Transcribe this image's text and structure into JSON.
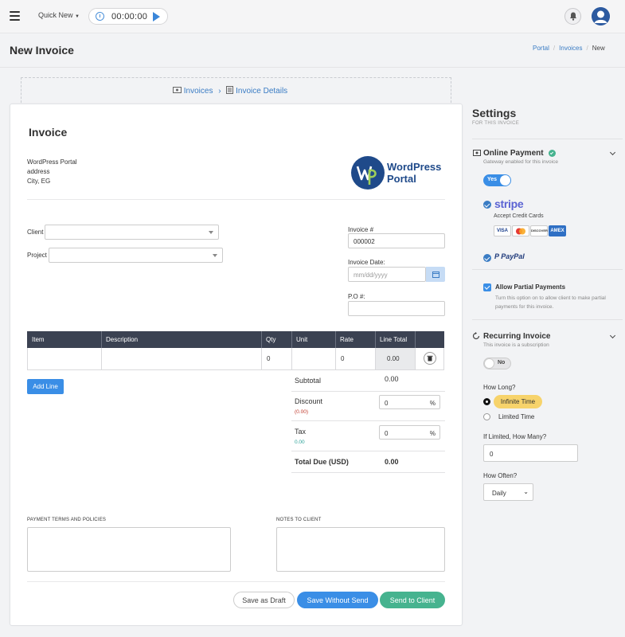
{
  "topbar": {
    "quick_new": "Quick New",
    "timer": "00:00:00"
  },
  "header": {
    "title": "New Invoice",
    "breadcrumb": [
      "Portal",
      "Invoices",
      "New"
    ]
  },
  "steps": {
    "step1": "Invoices",
    "step2": "Invoice Details"
  },
  "invoice": {
    "title": "Invoice",
    "company_lines": [
      "WordPress Portal",
      "address",
      "City, EG"
    ],
    "logo_text_line1": "WordPress",
    "logo_text_line2": "Portal",
    "client_label": "Client",
    "project_label": "Project",
    "invoice_no_label": "Invoice #",
    "invoice_no": "000002",
    "date_label": "Invoice Date:",
    "date_placeholder": "mm/dd/yyyy",
    "po_label": "P.O #:"
  },
  "table": {
    "headers": [
      "Item",
      "Description",
      "Qty",
      "Unit",
      "Rate",
      "Line Total"
    ],
    "row": {
      "qty": "0",
      "rate": "0",
      "total": "0.00"
    },
    "add_line": "Add Line"
  },
  "totals": {
    "subtotal_label": "Subtotal",
    "subtotal": "0.00",
    "discount_label": "Discount",
    "discount_value": "(0.00)",
    "discount_input": "0",
    "tax_label": "Tax",
    "tax_value": "0.00",
    "tax_input": "0",
    "percent": "%",
    "total_label": "Total Due (USD)",
    "total": "0.00"
  },
  "notes": {
    "terms_label": "PAYMENT TERMS AND POLICIES",
    "notes_label": "NOTES TO CLIENT"
  },
  "actions": {
    "draft": "Save as Draft",
    "save": "Save Without Send",
    "send": "Send to Client"
  },
  "settings": {
    "title": "Settings",
    "subtitle": "FOR THIS INVOICE",
    "online_payment": "Online Payment",
    "online_payment_sub": "Gateway enabled for this invoice",
    "toggle_yes": "Yes",
    "stripe": "stripe",
    "accept_cards": "Accept Credit Cards",
    "cards": [
      "VISA",
      "",
      "DISCOVER",
      "AMEX"
    ],
    "paypal": "PayPal",
    "partial_title": "Allow Partial Payments",
    "partial_sub": "Turn this option on to allow client to make partial payments for this invoice.",
    "recurring": "Recurring Invoice",
    "recurring_sub": "This invoice is a subscription",
    "toggle_no": "No",
    "how_long": "How Long?",
    "infinite": "Infinite Time",
    "limited": "Limited Time",
    "if_limited": "If Limited, How Many?",
    "how_many_value": "0",
    "how_often": "How Often?",
    "frequency": "Daily"
  },
  "colors": {
    "primary": "#3a8ee6",
    "success": "#46b38f",
    "dark_header": "#3b4252",
    "highlight": "#f7d36b"
  }
}
